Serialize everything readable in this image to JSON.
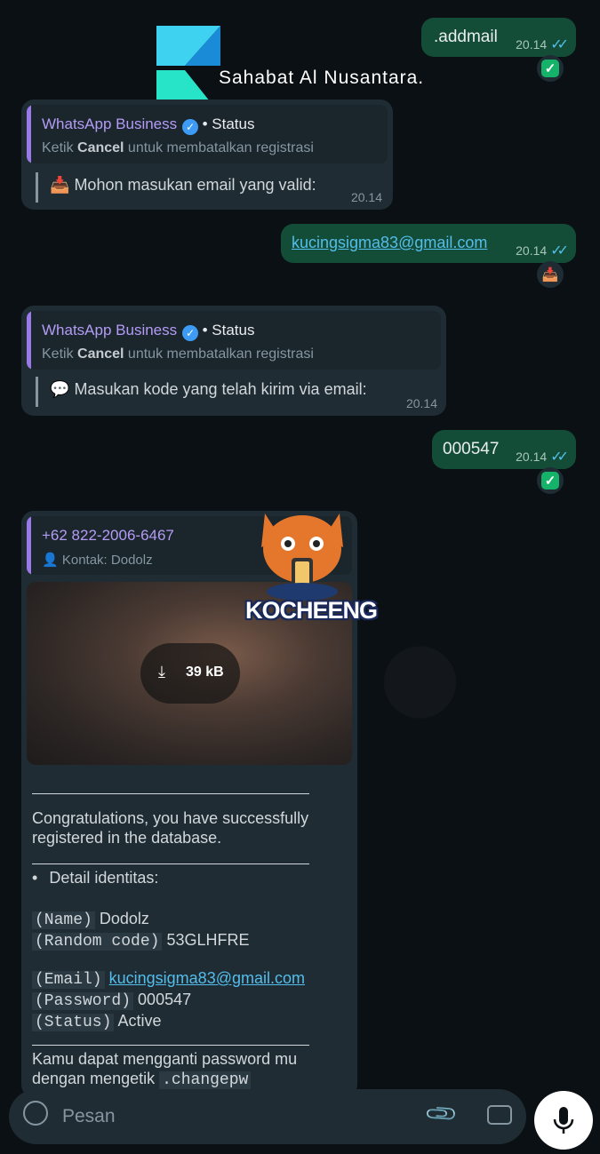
{
  "watermark": {
    "text": "Sahabat Al Nusantara."
  },
  "messages": {
    "m1": {
      "text": ".addmail",
      "time": "20.14"
    },
    "m2": {
      "sender": "WhatsApp Business",
      "status_label": "• Status",
      "hint_prefix": "Ketik ",
      "hint_bold": "Cancel",
      "hint_suffix": " untuk membatalkan registrasi",
      "emoji": "📥",
      "text": "Mohon masukan email yang valid:",
      "time": "20.14"
    },
    "m3": {
      "text": "kucingsigma83@gmail.com",
      "time": "20.14",
      "reaction": "📥"
    },
    "m4": {
      "sender": "WhatsApp Business",
      "status_label": "• Status",
      "hint_prefix": "Ketik ",
      "hint_bold": "Cancel",
      "hint_suffix": " untuk membatalkan registrasi",
      "emoji": "💬",
      "text": "Masukan kode yang telah kirim via email:",
      "time": "20.14"
    },
    "m5": {
      "text": "000547",
      "time": "20.14"
    },
    "m6": {
      "contact_number": "+62 822-2006-6467",
      "contact_label": "Kontak: Dodolz",
      "sticker_text": "KOCHEENG",
      "download_size": "39 kB",
      "congrats": "Congratulations, you have successfully registered in the database.",
      "detail_title": "Detail identitas:",
      "fields": {
        "name_key": "(Name)",
        "name_val": "Dodolz",
        "code_key": "(Random code)",
        "code_val": "53GLHFRE",
        "email_key": "(Email)",
        "email_val": "kucingsigma83@gmail.com",
        "password_key": "(Password)",
        "password_val": "000547",
        "status_key": "(Status)",
        "status_val": "Active"
      },
      "footer_line1": "Kamu dapat mengganti password mu",
      "footer_line2_prefix": "dengan mengetik ",
      "footer_line2_code": ".changepw"
    }
  },
  "input": {
    "placeholder": "Pesan"
  }
}
